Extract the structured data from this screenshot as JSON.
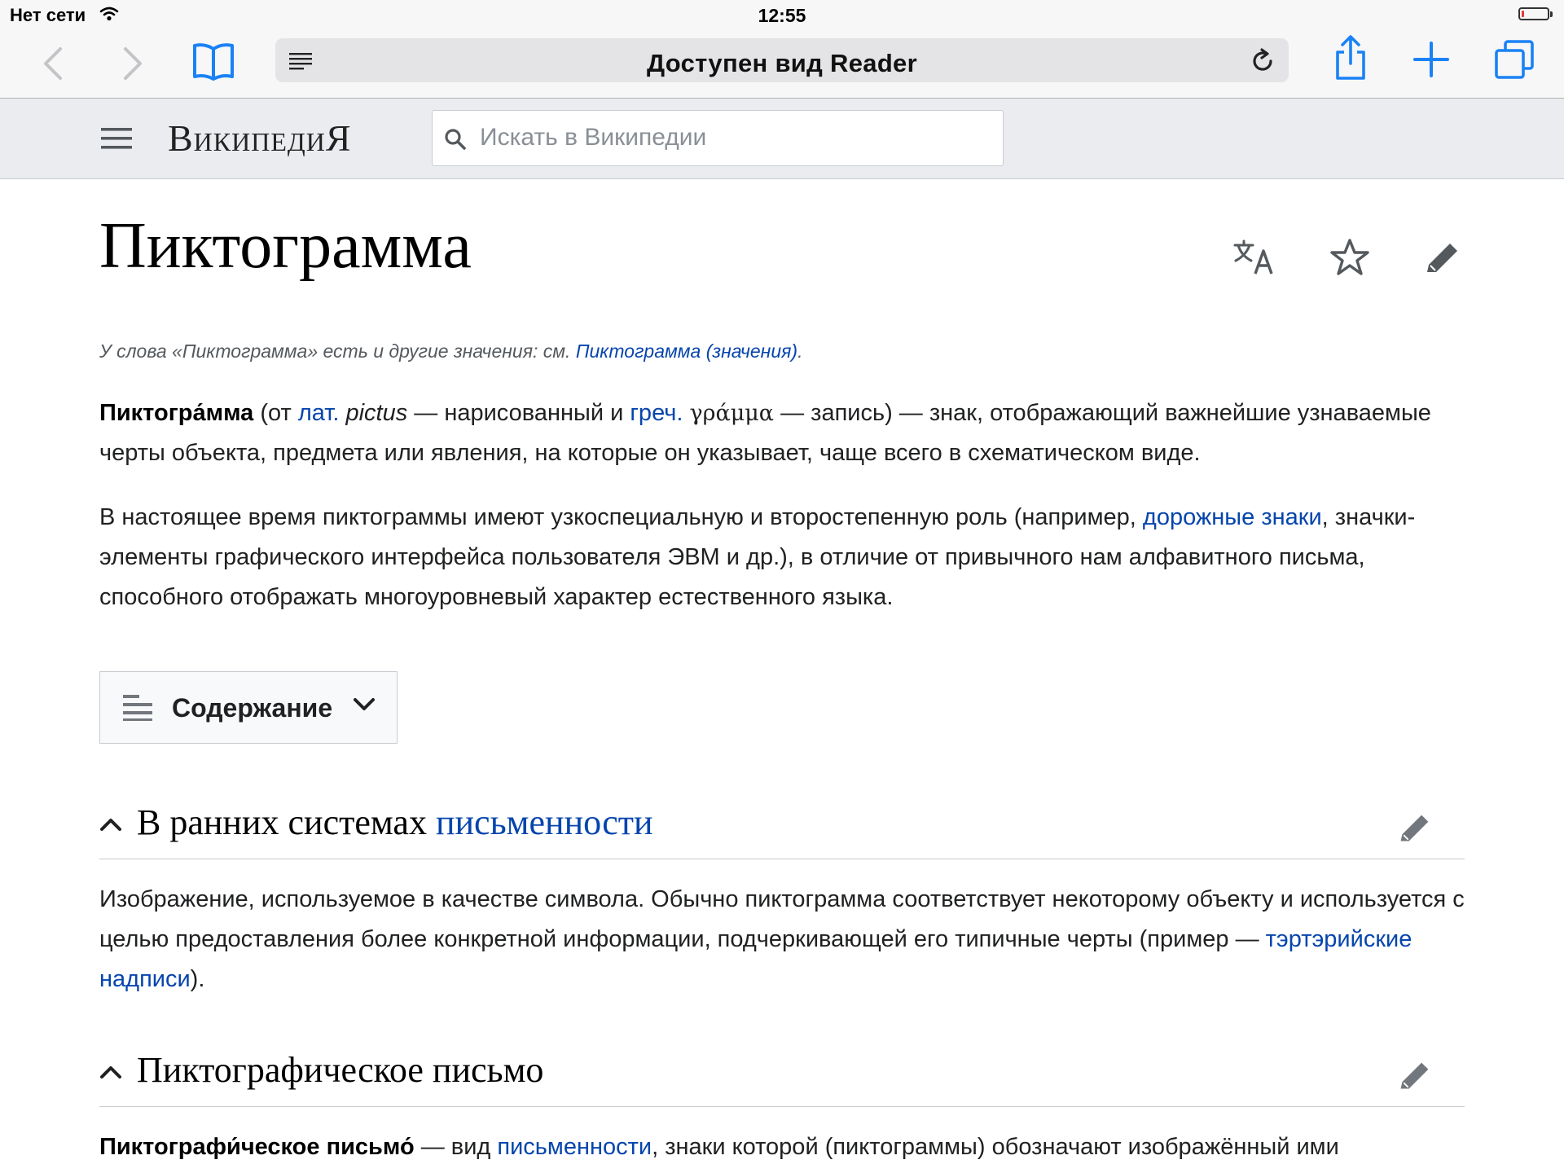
{
  "status_bar": {
    "carrier": "Нет сети",
    "time": "12:55",
    "battery_level": 0.1
  },
  "toolbar": {
    "address_text": "Доступен вид Reader",
    "icons": [
      "back-icon",
      "forward-icon",
      "bookmarks-icon",
      "reader-icon",
      "reload-icon",
      "share-icon",
      "new-tab-icon",
      "tabs-icon"
    ]
  },
  "wiki_header": {
    "logo": "ВикипедиЯ",
    "search_placeholder": "Искать в Википедии"
  },
  "article": {
    "title": "Пиктограмма",
    "hatnote": {
      "prefix": "У слова «Пиктограмма» есть и другие значения: см. ",
      "link": "Пиктограмма (значения)",
      "suffix": "."
    },
    "intro": {
      "term": "Пиктогра́мма",
      "t1": " (от ",
      "lat_link": "лат.",
      "t2": " ",
      "lat_word": "pictus",
      "t3": " — нарисованный и ",
      "greek_link": "греч.",
      "t4": " ",
      "greek_word": "γράμμα",
      "t5": " — запись) — знак, отображающий важнейшие узнаваемые черты объекта, предмета или явления, на которые он указывает, чаще всего в схематическом виде."
    },
    "para2": {
      "t1": "В настоящее время пиктограммы имеют узкоспециальную и второстепенную роль (например, ",
      "link": "дорожные знаки",
      "t2": ", значки-элементы графического интерфейса пользователя ЭВМ и др.), в отличие от привычного нам алфавитного письма, способного отображать многоуровневый характер естественного языка."
    },
    "toc_label": "Содержание",
    "section1": {
      "title_plain": "В ранних системах ",
      "title_link": "письменности",
      "text1": "Изображение, используемое в качестве символа. Обычно пиктограмма соответствует некоторому объекту и используется с целью предоставления более конкретной информации, подчеркивающей его типичные черты (пример — ",
      "link": "тэртэрийские надписи",
      "text2": ")."
    },
    "section2": {
      "title": "Пиктографическое письмо",
      "term": "Пиктографи́ческое письмо́",
      "t1": " — вид ",
      "link": "письменности",
      "t2": ", знаки которой (пиктограммы) обозначают изображённый ими"
    }
  },
  "colors": {
    "link": "#0645ad",
    "ios_blue": "#1a82f6",
    "header_bg": "#eaecf0",
    "battery_red": "#e53935"
  }
}
